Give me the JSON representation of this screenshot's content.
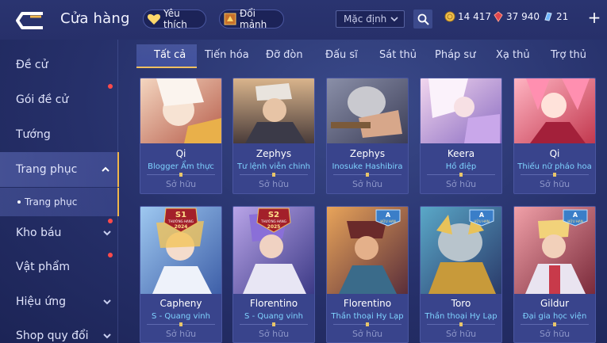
{
  "header": {
    "title": "Cửa hàng",
    "favorite_label": "Yêu thích",
    "trade_label": "Đổi mảnh",
    "sort_label": "Mặc định",
    "currencies": {
      "gold": "14 417",
      "ruby": "37 940",
      "voucher": "21"
    },
    "plus_label": "+"
  },
  "sidebar": {
    "items": [
      {
        "label": "Đề cử"
      },
      {
        "label": "Gói đề cử"
      },
      {
        "label": "Tướng"
      },
      {
        "label": "Trang phục"
      },
      {
        "label": "Trang phục"
      },
      {
        "label": "Kho báu"
      },
      {
        "label": "Vật phẩm"
      },
      {
        "label": "Hiệu ứng"
      },
      {
        "label": "Shop quy đổi"
      }
    ]
  },
  "tabs": [
    "Tất cả",
    "Tiến hóa",
    "Đỡ đòn",
    "Đấu sĩ",
    "Sát thủ",
    "Pháp sư",
    "Xạ thủ",
    "Trợ thủ"
  ],
  "cards": [
    {
      "hero": "Qi",
      "skin": "Blogger Ẩm thực",
      "status": "Sở hữu"
    },
    {
      "hero": "Zephys",
      "skin": "Tư lệnh viễn chinh",
      "status": "Sở hữu"
    },
    {
      "hero": "Zephys",
      "skin": "Inosuke Hashibira",
      "status": "Sở hữu"
    },
    {
      "hero": "Keera",
      "skin": "Hồ điệp",
      "status": "Sở hữu"
    },
    {
      "hero": "Qi",
      "skin": "Thiếu nữ pháo hoa",
      "status": "Sở hữu"
    },
    {
      "hero": "Capheny",
      "skin": "S - Quang vinh",
      "status": "Sở hữu",
      "badge_text": "S1",
      "badge_sub": "THƯỜNG HẠNG",
      "badge_year": "2024"
    },
    {
      "hero": "Florentino",
      "skin": "S - Quang vinh",
      "status": "Sở hữu",
      "badge_text": "S2",
      "badge_sub": "THƯỜNG HẠNG",
      "badge_year": "2025"
    },
    {
      "hero": "Florentino",
      "skin": "Thần thoại Hy Lạp",
      "status": "Sở hữu",
      "badge_text": "A",
      "badge_sub": "HỮU HẠN"
    },
    {
      "hero": "Toro",
      "skin": "Thần thoại Hy Lạp",
      "status": "Sở hữu",
      "badge_text": "A",
      "badge_sub": "HỮU HẠN"
    },
    {
      "hero": "Gildur",
      "skin": "Đại gia học viện",
      "status": "Sở hữu",
      "badge_text": "A",
      "badge_sub": "HỮU HẠN"
    }
  ],
  "colors": {
    "accent_gold": "#f0b64a",
    "skin_blue": "#7fd3ff",
    "notification_red": "#ff4a4a",
    "card_bg": "#39448c"
  },
  "icons": {
    "back": "back-arrow-icon",
    "favorite": "heart-icon",
    "trade": "shard-exchange-icon",
    "search": "search-icon",
    "gold": "gold-coin-icon",
    "ruby": "ruby-gem-icon",
    "voucher": "voucher-icon"
  }
}
